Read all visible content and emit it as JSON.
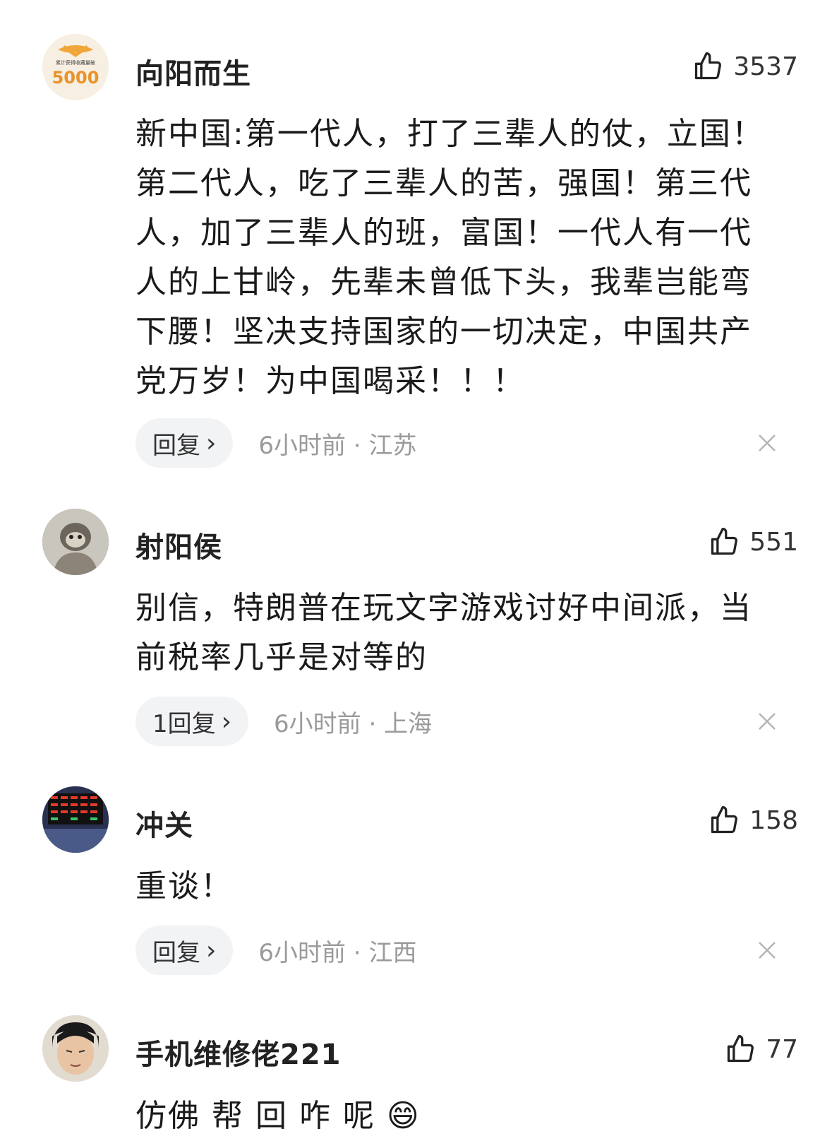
{
  "comments": [
    {
      "username": "向阳而生",
      "avatar_badge_top": "累计获得收藏量破",
      "avatar_badge_num": "5000",
      "likes": "3537",
      "content": "新中国:第一代人，打了三辈人的仗，立国！\n第二代人，吃了三辈人的苦，强国！第三代\n人，加了三辈人的班，富国！一代人有一代\n人的上甘岭，先辈未曾低下头，我辈岂能弯\n下腰！坚决支持国家的一切决定，中国共产\n党万岁！为中国喝采！！！",
      "reply_label": "回复",
      "time_location": "6小时前 · 江苏"
    },
    {
      "username": "射阳侯",
      "likes": "551",
      "content": "别信，特朗普在玩文字游戏讨好中间派，当\n前税率几乎是对等的",
      "reply_label": "1回复",
      "time_location": "6小时前 · 上海"
    },
    {
      "username": "冲关",
      "likes": "158",
      "content": "重谈！",
      "reply_label": "回复",
      "time_location": "6小时前 · 江西"
    },
    {
      "username": "手机维修佬221",
      "likes": "77",
      "content": "仿佛 帮 回 咋 呢 😄"
    }
  ],
  "icons": {
    "like": "thumbs-up-icon",
    "close": "close-icon",
    "chevron": "chevron-right-icon"
  },
  "colors": {
    "pill_bg": "#f2f3f5",
    "meta_text": "#9a9a9a"
  }
}
